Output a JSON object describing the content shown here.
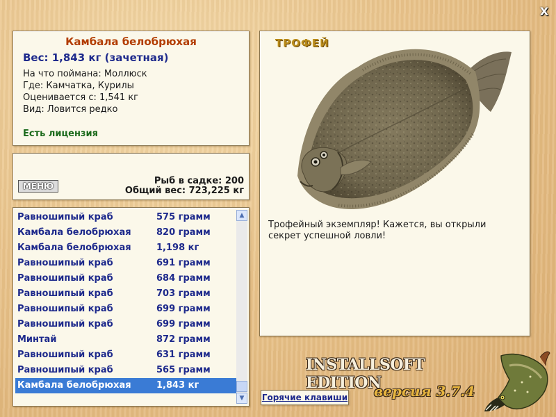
{
  "window": {
    "close_label": "X"
  },
  "catch_info": {
    "fish_name": "Камбала белобрюхая",
    "weight_text": "Вес: 1,843 кг (зачетная)",
    "bait_text": "На что поймана: Моллюск",
    "location_text": "Где: Камчатка, Курилы",
    "price_text": "Оценивается с: 1,541 кг",
    "rarity_text": "Вид: Ловится редко",
    "license_text": "Есть лицензия"
  },
  "status": {
    "menu_label": "МЕНЮ",
    "keep_net_text": "Рыб в садке: 200",
    "total_weight_text": "Общий вес: 723,225 кг"
  },
  "catch_list": [
    {
      "name": "Равношипый краб",
      "weight": "575 грамм"
    },
    {
      "name": "Камбала белобрюхая",
      "weight": "820 грамм"
    },
    {
      "name": "Камбала белобрюхая",
      "weight": "1,198 кг"
    },
    {
      "name": "Равношипый краб",
      "weight": "691 грамм"
    },
    {
      "name": "Равношипый краб",
      "weight": "684 грамм"
    },
    {
      "name": "Равношипый краб",
      "weight": "703 грамм"
    },
    {
      "name": "Равношипый краб",
      "weight": "699 грамм"
    },
    {
      "name": "Равношипый краб",
      "weight": "699 грамм"
    },
    {
      "name": "Минтай",
      "weight": "872 грамм"
    },
    {
      "name": "Равношипый краб",
      "weight": "631 грамм"
    },
    {
      "name": "Равношипый краб",
      "weight": "565 грамм"
    },
    {
      "name": "Камбала белобрюхая",
      "weight": "1,843 кг",
      "selected": true
    }
  ],
  "trophy": {
    "title": "ТРОФЕЙ",
    "message": "Трофейный экземпляр! Кажется, вы открыли секрет успешной ловли!"
  },
  "footer": {
    "hotkeys_label": "Горячие клавиши",
    "brand_text": "INSTALLSOFT EDITION",
    "version_text": "версия 3.7.4"
  },
  "icons": {
    "close": "close-icon",
    "scroll_up": "chevron-up-icon",
    "scroll_down": "chevron-down-icon",
    "trophy_image": "flounder-fish-image",
    "logo": "pike-fish-logo"
  },
  "colors": {
    "fish_name": "#b23c00",
    "weight": "#1e2a8c",
    "license": "#1b6a1b",
    "selection": "#3a7bd5",
    "panel_bg": "#fbf8ea"
  }
}
